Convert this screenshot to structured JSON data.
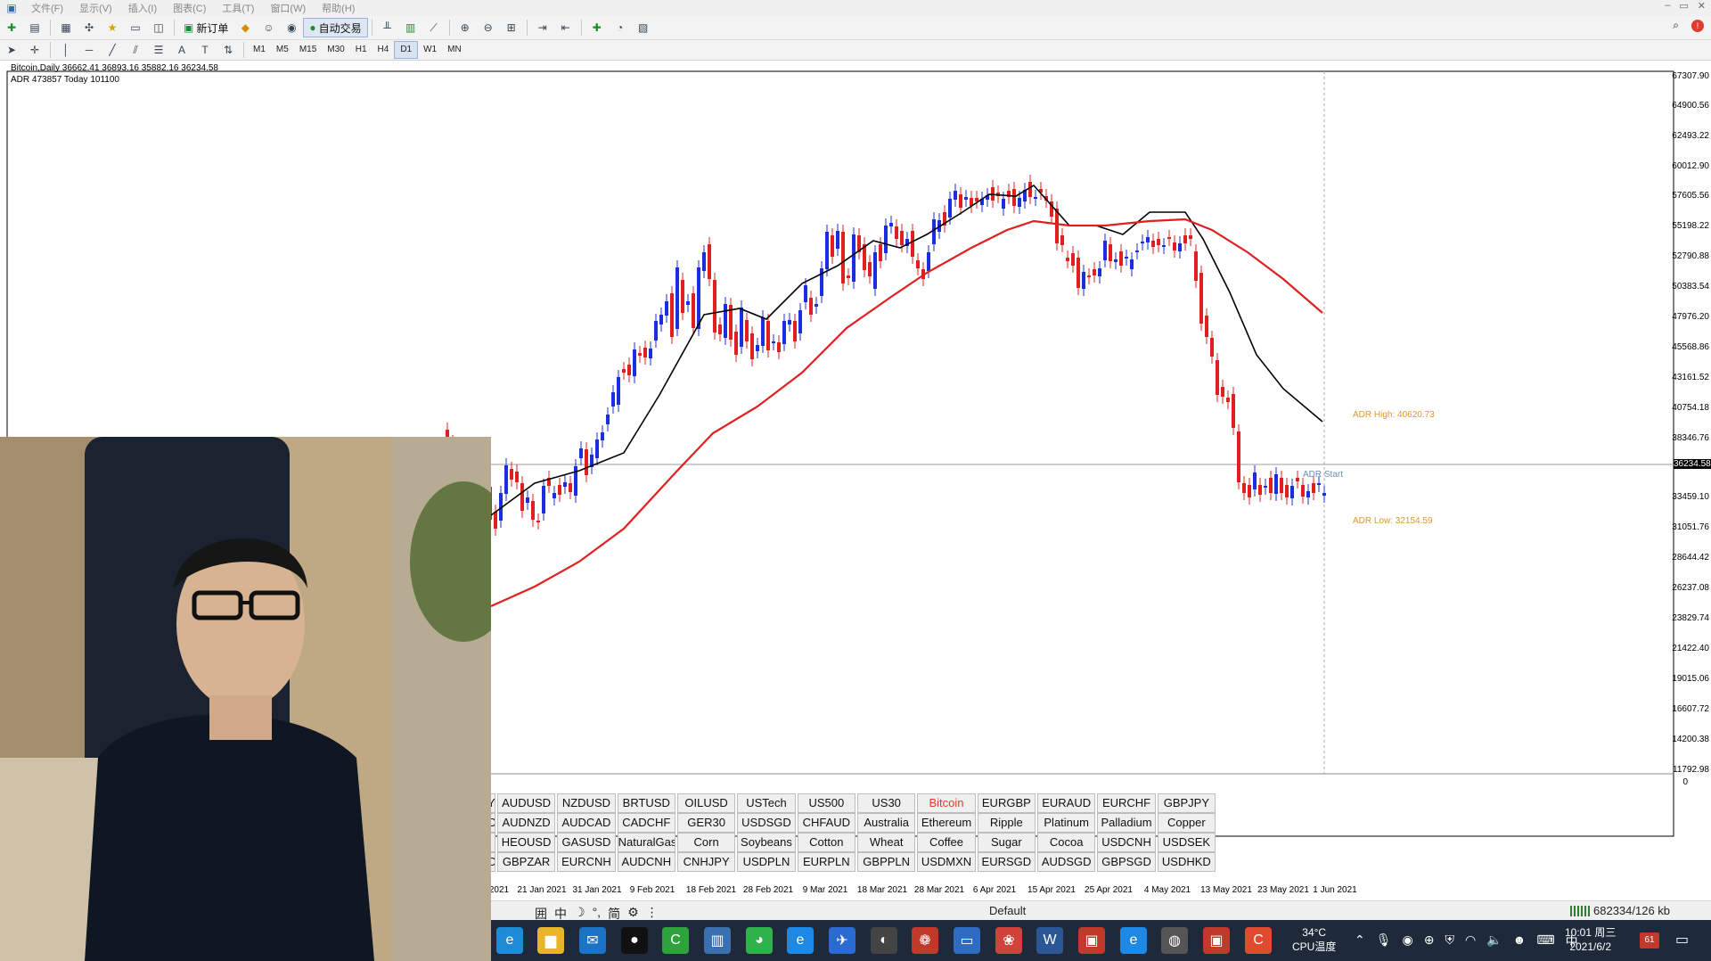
{
  "menubar": {
    "items": [
      "文件(F)",
      "显示(V)",
      "插入(I)",
      "图表(C)",
      "工具(T)",
      "窗口(W)",
      "帮助(H)"
    ]
  },
  "toolbar": {
    "new_order_label": "新订单",
    "auto_trading_label": "自动交易"
  },
  "timeframes": [
    "M1",
    "M5",
    "M15",
    "M30",
    "H1",
    "H4",
    "D1",
    "W1",
    "MN"
  ],
  "active_timeframe": "D1",
  "chart": {
    "title_line1": "Bitcoin,Daily  36662.41 36893.16 35882.16 36234.58",
    "title_line2": "ADR 473857  Today 101100",
    "price_labels": [
      "67307.90",
      "64900.56",
      "62493.22",
      "60012.90",
      "57605.56",
      "55198.22",
      "52790.88",
      "50383.54",
      "47976.20",
      "45568.86",
      "43161.52",
      "40754.18",
      "38346.76",
      "33459.10",
      "31051.76",
      "28644.42",
      "26237.08",
      "23829.74",
      "21422.40",
      "19015.06",
      "16607.72",
      "14200.38",
      "11792.98"
    ],
    "current_price_marker": "36234.58",
    "indicator_zero": "0",
    "adr_high_label": "ADR High: 40620.73",
    "adr_low_label": "ADR Low: 32154.59",
    "adr_start_label": "ADR Start",
    "date_labels": [
      "2021",
      "21 Jan 2021",
      "31 Jan 2021",
      "9 Feb 2021",
      "18 Feb 2021",
      "28 Feb 2021",
      "9 Mar 2021",
      "18 Mar 2021",
      "28 Mar 2021",
      "6 Apr 2021",
      "15 Apr 2021",
      "25 Apr 2021",
      "4 May 2021",
      "13 May 2021",
      "23 May 2021",
      "1 Jun 2021"
    ],
    "colors": {
      "bull": "#1a2ee0",
      "bear": "#e02020",
      "ma_fast": "#000000",
      "ma_slow": "#e02020",
      "adr": "#e0982a"
    }
  },
  "symbols": {
    "rows": [
      [
        "AUDUSD",
        "NZDUSD",
        "BRTUSD",
        "OILUSD",
        "USTech",
        "US500",
        "US30",
        "Bitcoin",
        "EURGBP",
        "EURAUD",
        "EURCHF",
        "GBPJPY"
      ],
      [
        "AUDNZD",
        "AUDCAD",
        "CADCHF",
        "GER30",
        "USDSGD",
        "CHFAUD",
        "Australia",
        "Ethereum",
        "Ripple",
        "Platinum",
        "Palladium",
        "Copper"
      ],
      [
        "HEOUSD",
        "GASUSD",
        "NaturalGas",
        "Corn",
        "Soybeans",
        "Cotton",
        "Wheat",
        "Coffee",
        "Sugar",
        "Cocoa",
        "USDCNH",
        "USDSEK"
      ],
      [
        "GBPZAR",
        "EURCNH",
        "AUDCNH",
        "CNHJPY",
        "USDPLN",
        "EURPLN",
        "GBPPLN",
        "USDMXN",
        "EURSGD",
        "AUDSGD",
        "GBPSGD",
        "USDHKD"
      ]
    ],
    "partial_left": [
      "Y",
      "O",
      "",
      "O"
    ],
    "selected": "Bitcoin"
  },
  "statusbar": {
    "ime": [
      "囲",
      "中",
      "☽",
      "°,",
      "简",
      "⚙",
      "⋮"
    ],
    "profile": "Default",
    "connection": "682334/126 kb"
  },
  "taskbar": {
    "temperature": "34°C",
    "temperature_label": "CPU温度",
    "time": "10:01 周三",
    "date": "2021/6/2",
    "ime_lang": "中",
    "notification_count": "61"
  }
}
